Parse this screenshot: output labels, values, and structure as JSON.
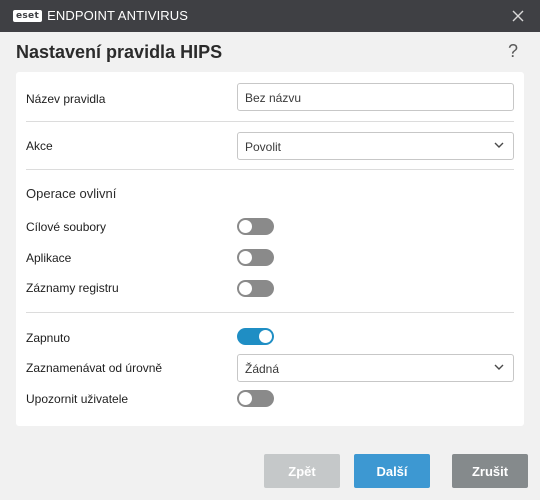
{
  "window": {
    "brand": "eset",
    "product": "ENDPOINT ANTIVIRUS",
    "close_icon": "close-icon"
  },
  "dialog": {
    "title": "Nastavení pravidla HIPS",
    "help": "?"
  },
  "form": {
    "rule_name": {
      "label": "Název pravidla",
      "value": "Bez názvu"
    },
    "action": {
      "label": "Akce",
      "value": "Povolit"
    },
    "operations_heading": "Operace ovlivní",
    "target_files": {
      "label": "Cílové soubory",
      "enabled": false
    },
    "applications": {
      "label": "Aplikace",
      "enabled": false
    },
    "registry_entries": {
      "label": "Záznamy registru",
      "enabled": false
    },
    "enabled": {
      "label": "Zapnuto",
      "enabled": true
    },
    "log_level": {
      "label": "Zaznamenávat od úrovně",
      "value": "Žádná"
    },
    "notify_user": {
      "label": "Upozornit uživatele",
      "enabled": false
    }
  },
  "buttons": {
    "back": "Zpět",
    "next": "Další",
    "cancel": "Zrušit"
  },
  "colors": {
    "titlebar": "#3f4044",
    "toggle_on": "#1f8ec4",
    "toggle_off": "#8a8a8a",
    "primary_button": "#3d98d2",
    "disabled_button": "#c5c8c9",
    "cancel_button": "#858a8c"
  }
}
